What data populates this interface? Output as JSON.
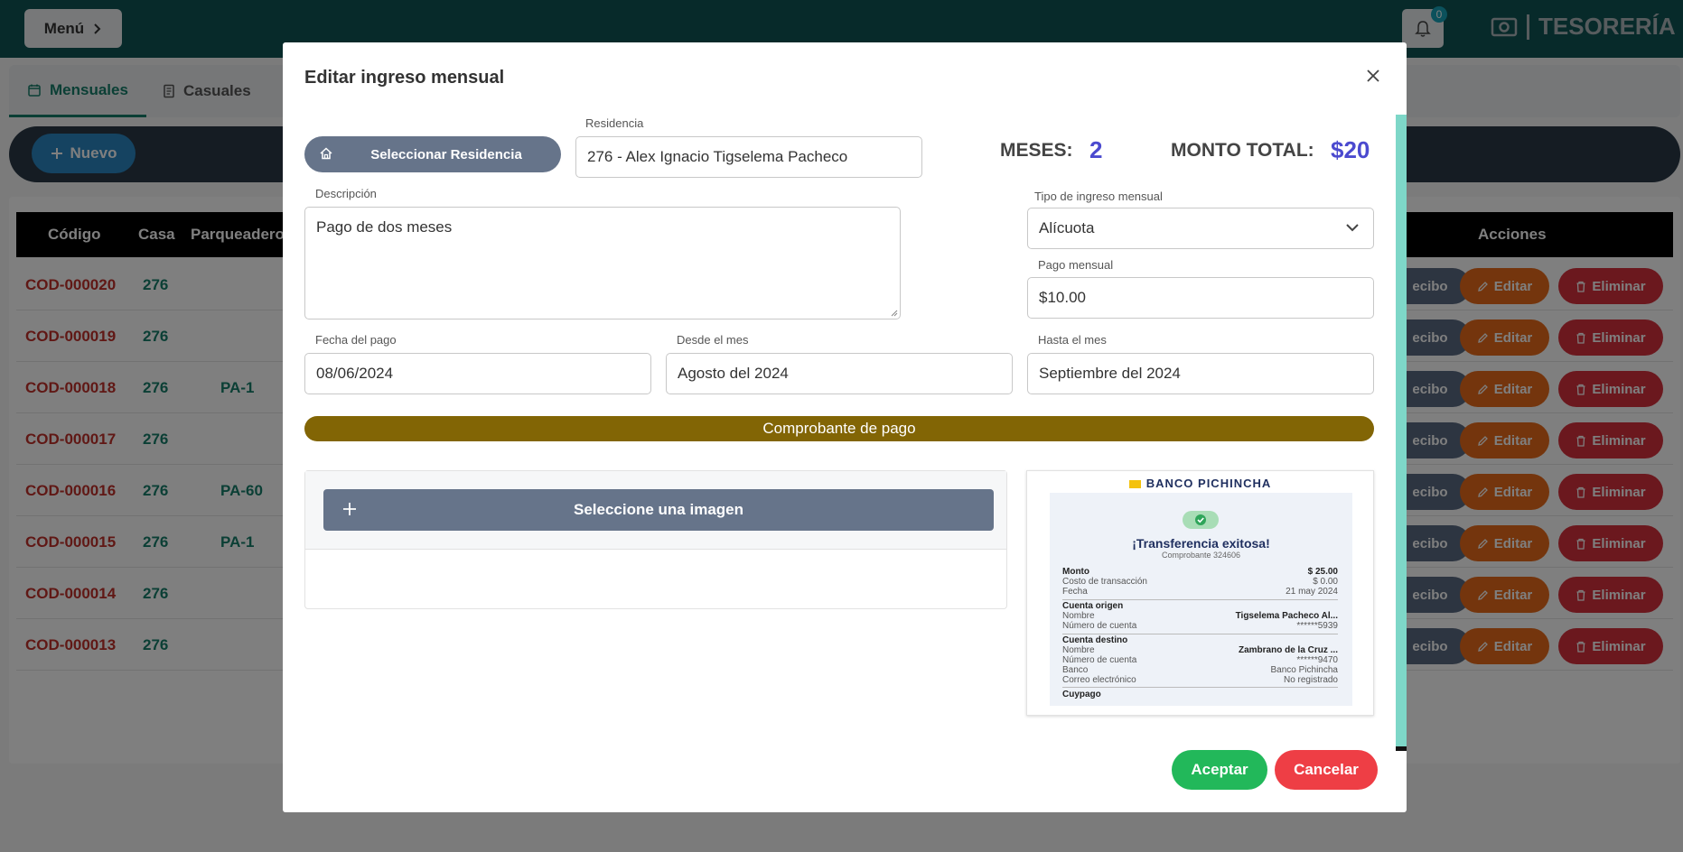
{
  "topbar": {
    "menu_label": "Menú",
    "notification_count": "0",
    "brand_title": "TESORERÍA"
  },
  "tabs": [
    {
      "label": "Mensuales"
    },
    {
      "label": "Casuales"
    }
  ],
  "actions": {
    "new_label": "Nuevo"
  },
  "table": {
    "headers": {
      "codigo": "Código",
      "casa": "Casa",
      "parqueadero": "Parqueadero",
      "acciones": "Acciones"
    },
    "recibo_label": "ecibo",
    "editar_label": "Editar",
    "eliminar_label": "Eliminar",
    "rows": [
      {
        "code": "COD-000020",
        "casa": "276",
        "parqueadero": ""
      },
      {
        "code": "COD-000019",
        "casa": "276",
        "parqueadero": ""
      },
      {
        "code": "COD-000018",
        "casa": "276",
        "parqueadero": "PA-1"
      },
      {
        "code": "COD-000017",
        "casa": "276",
        "parqueadero": ""
      },
      {
        "code": "COD-000016",
        "casa": "276",
        "parqueadero": "PA-60"
      },
      {
        "code": "COD-000015",
        "casa": "276",
        "parqueadero": "PA-1"
      },
      {
        "code": "COD-000014",
        "casa": "276",
        "parqueadero": ""
      },
      {
        "code": "COD-000013",
        "casa": "276",
        "parqueadero": ""
      }
    ]
  },
  "modal": {
    "title": "Editar ingreso mensual",
    "select_residence_label": "Seleccionar Residencia",
    "residence_label": "Residencia",
    "residence_value": "276 - Alex Ignacio Tigselema Pacheco",
    "meses_label": "MESES:",
    "meses_value": "2",
    "monto_label": "MONTO TOTAL:",
    "monto_value": "$20",
    "descripcion_label": "Descripción",
    "descripcion_value": "Pago de dos meses",
    "tipo_label": "Tipo de ingreso mensual",
    "tipo_value": "Alícuota",
    "pago_label": "Pago mensual",
    "pago_value": "$10.00",
    "fecha_label": "Fecha del pago",
    "fecha_value": "08/06/2024",
    "desde_label": "Desde el mes",
    "desde_value": "Agosto del 2024",
    "hasta_label": "Hasta el mes",
    "hasta_value": "Septiembre del 2024",
    "comprobante_label": "Comprobante de pago",
    "select_image_label": "Seleccione una imagen",
    "aceptar_label": "Aceptar",
    "cancelar_label": "Cancelar"
  },
  "receipt": {
    "bank": "BANCO PICHINCHA",
    "title": "¡Transferencia exitosa!",
    "comprobante": "Comprobante 324606",
    "monto_label": "Monto",
    "monto_value": "$ 25.00",
    "costo_label": "Costo de transacción",
    "costo_value": "$ 0.00",
    "fecha_label": "Fecha",
    "fecha_value": "21 may 2024",
    "origen_title": "Cuenta origen",
    "nombre_label": "Nombre",
    "origen_nombre": "Tigselema Pacheco Al...",
    "numero_label": "Número de cuenta",
    "origen_numero": "******5939",
    "destino_title": "Cuenta destino",
    "destino_nombre": "Zambrano de la Cruz ...",
    "destino_numero": "******9470",
    "banco_label": "Banco",
    "banco_value": "Banco Pichincha",
    "correo_label": "Correo electrónico",
    "correo_value": "No registrado",
    "footer": "Cuypago"
  },
  "colors": {
    "topbar": "#0f5554",
    "accent_teal": "#167e6b",
    "code_red": "#c0302b",
    "comprobante_bar": "#826505",
    "accept_green": "#22b85a",
    "cancel_red": "#ee3e45",
    "total_blue": "#4b4acf"
  }
}
